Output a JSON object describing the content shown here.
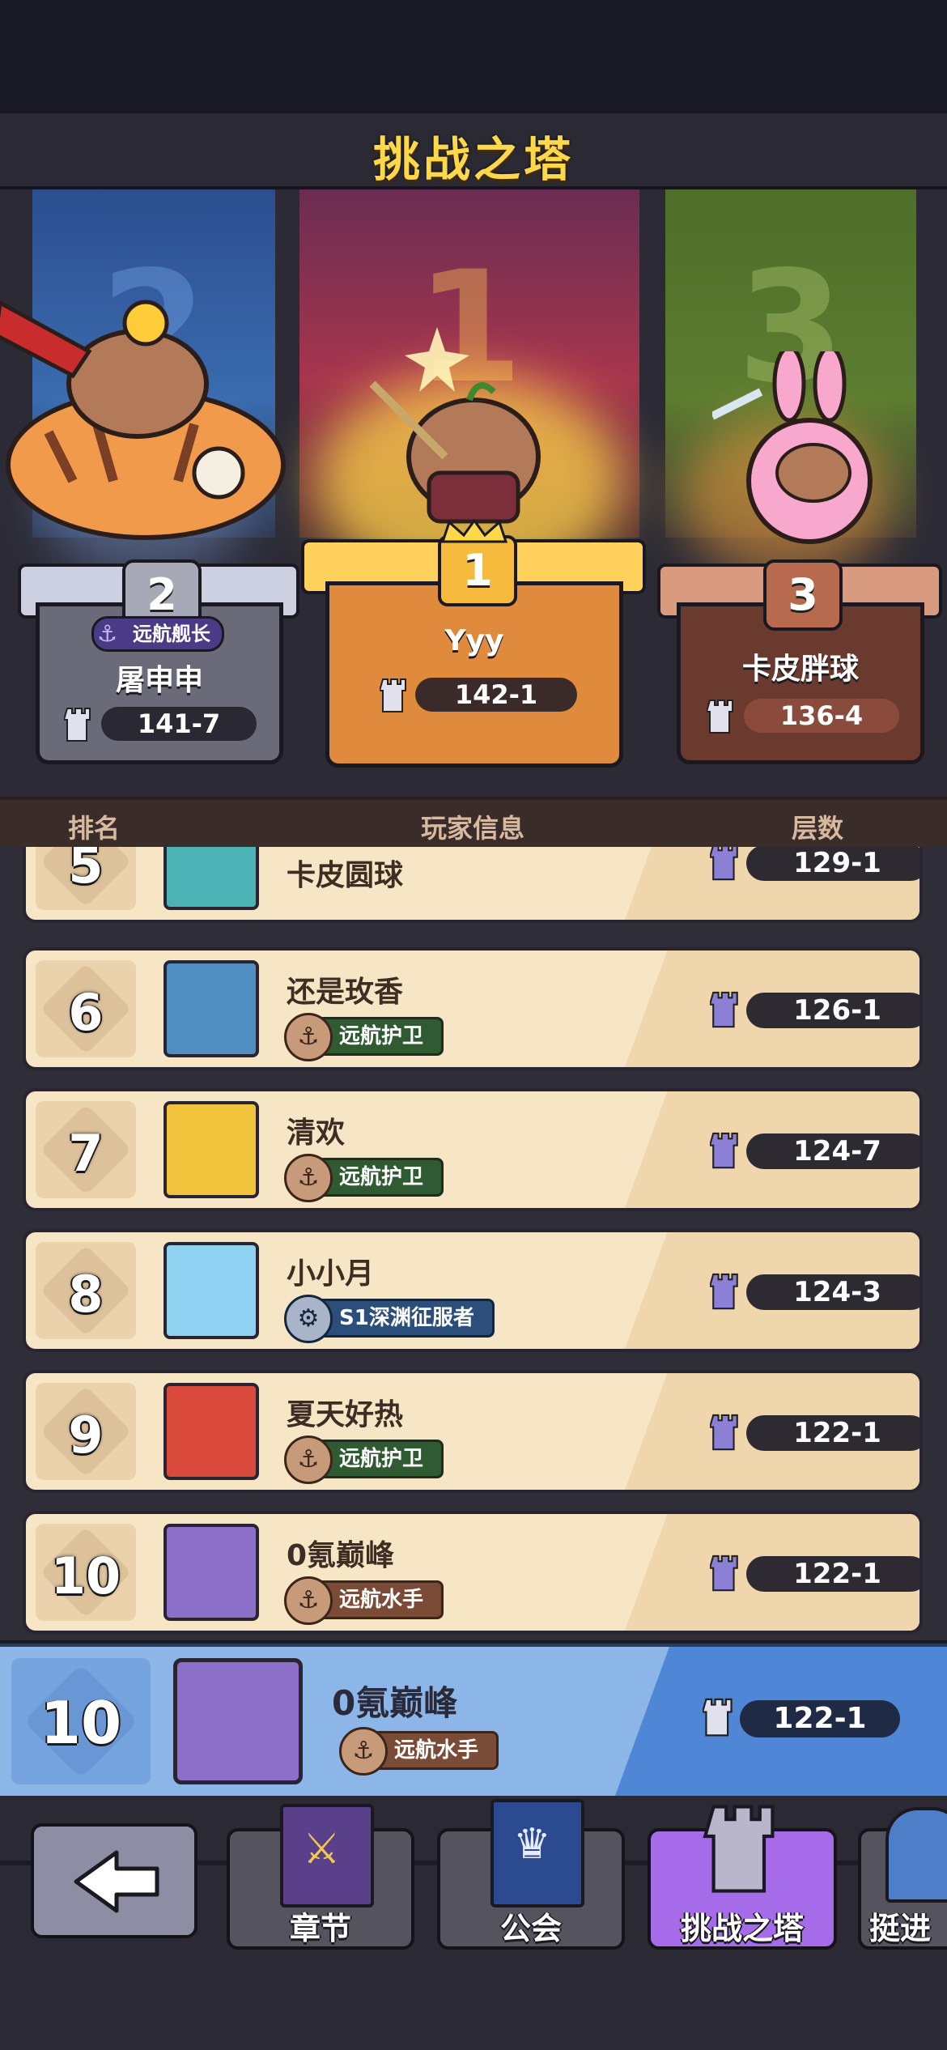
{
  "header": {
    "title": "挑战之塔"
  },
  "podium": [
    {
      "rank": "2",
      "banner_number": "2",
      "name": "屠申申",
      "title_badge": "远航舰长",
      "score": "141-7"
    },
    {
      "rank": "1",
      "banner_number": "1",
      "name": "Yyy",
      "score": "142-1"
    },
    {
      "rank": "3",
      "banner_number": "3",
      "name": "卡皮胖球",
      "score": "136-4"
    }
  ],
  "table_header": {
    "rank": "排名",
    "player_info": "玩家信息",
    "floors": "层数"
  },
  "rows": [
    {
      "rank": "5",
      "name": "卡皮圆球",
      "badge": "",
      "score": "129-1"
    },
    {
      "rank": "6",
      "name": "还是玫香",
      "badge": "远航护卫",
      "score": "126-1"
    },
    {
      "rank": "7",
      "name": "清欢",
      "badge": "远航护卫",
      "score": "124-7"
    },
    {
      "rank": "8",
      "name": "小小月",
      "badge": "S1深渊征服者",
      "score": "124-3"
    },
    {
      "rank": "9",
      "name": "夏天好热",
      "badge": "远航护卫",
      "score": "122-1"
    },
    {
      "rank": "10",
      "name": "0氪巅峰",
      "badge": "远航水手",
      "score": "122-1"
    }
  ],
  "self": {
    "rank": "10",
    "name": "0氪巅峰",
    "badge": "远航水手",
    "score": "122-1"
  },
  "nav": {
    "chapter": "章节",
    "guild": "公会",
    "tower": "挑战之塔",
    "advance": "挺进"
  },
  "colors": {
    "accent_title": "#ffd84a",
    "gold": "#f0a94a",
    "silver": "#9a9aa6",
    "bronze": "#a0553e",
    "self_row": "#8bb6e7",
    "active_tab": "#a66be8"
  }
}
